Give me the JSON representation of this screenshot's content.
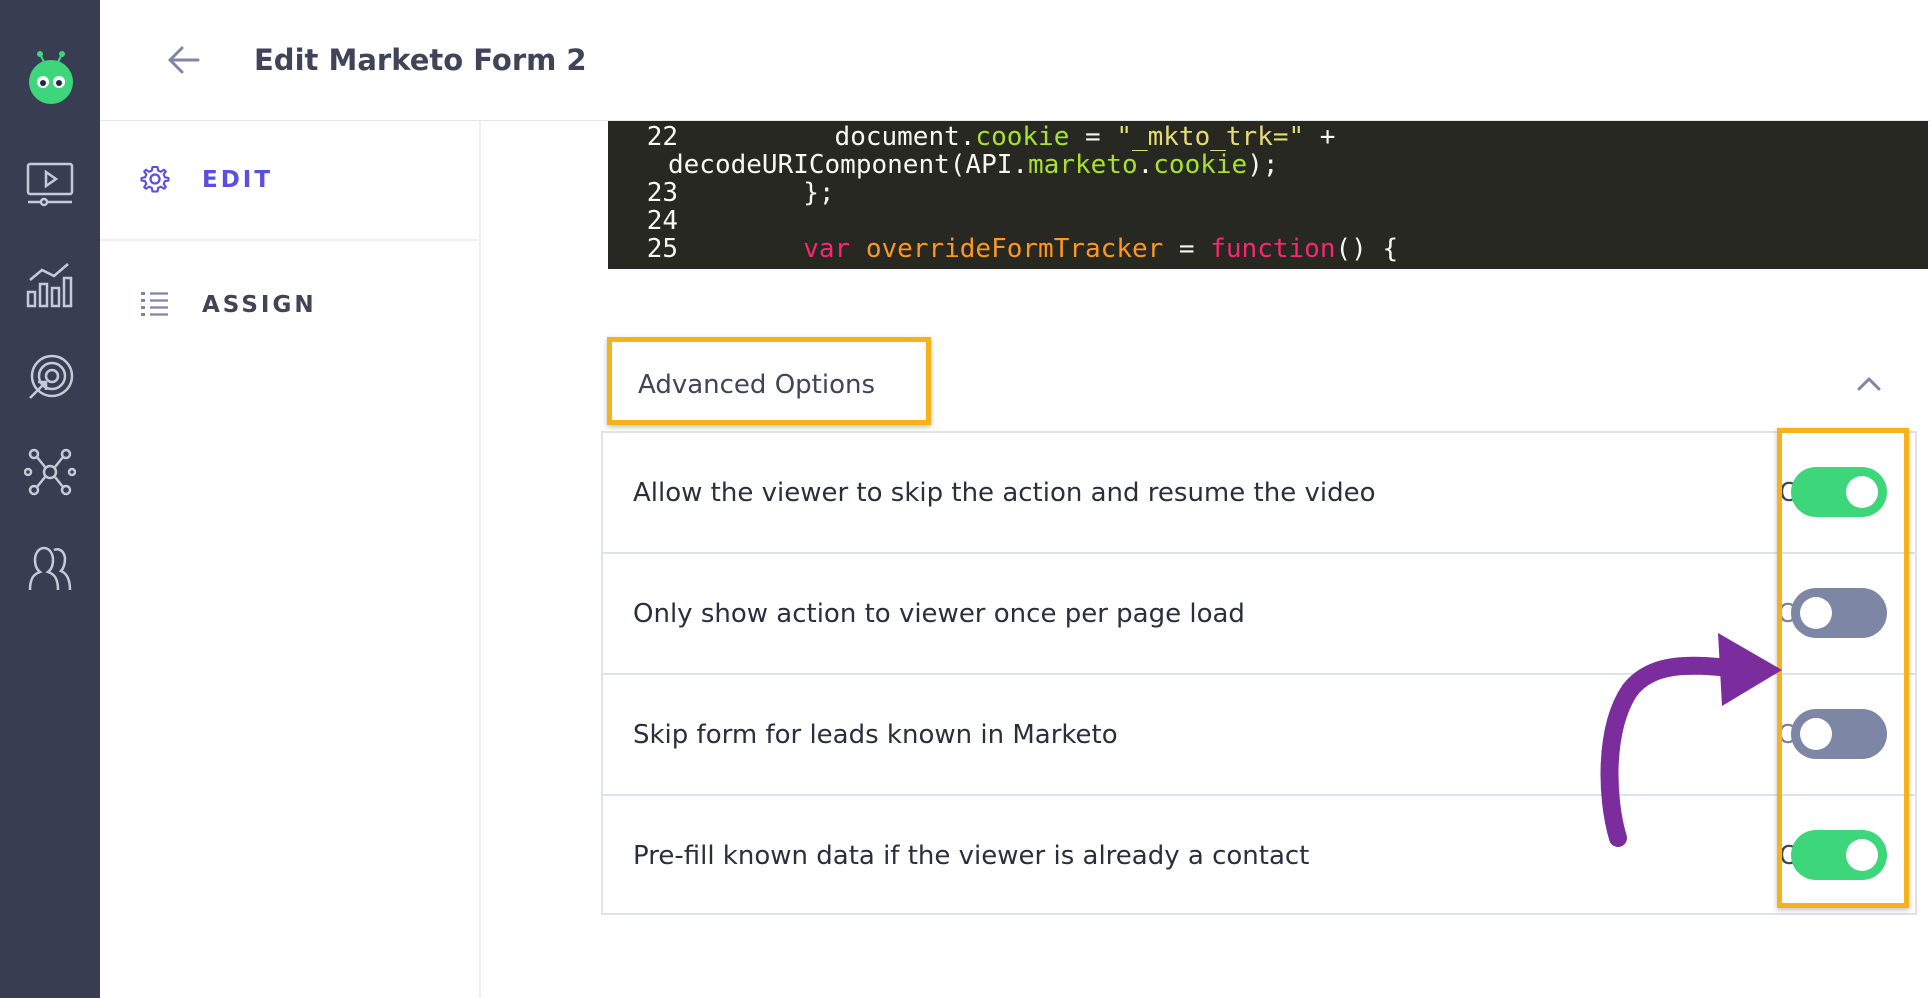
{
  "header": {
    "title": "Edit Marketo Form 2"
  },
  "subnav": {
    "items": [
      {
        "label": "EDIT",
        "icon": "gear-icon",
        "active": true
      },
      {
        "label": "ASSIGN",
        "icon": "list-icon",
        "active": false
      }
    ]
  },
  "code": {
    "lines": [
      {
        "num": "22",
        "parts": [
          {
            "t": "        document.",
            "c": ""
          },
          {
            "t": "cookie",
            "c": "c-prop"
          },
          {
            "t": " = ",
            "c": ""
          },
          {
            "t": "\"_mkto_trk=\"",
            "c": "c-str"
          },
          {
            "t": " +",
            "c": ""
          }
        ]
      },
      {
        "num": "",
        "parts": [
          {
            "t": "decodeURIComponent(API.",
            "c": ""
          },
          {
            "t": "marketo",
            "c": "c-prop"
          },
          {
            "t": ".",
            "c": ""
          },
          {
            "t": "cookie",
            "c": "c-prop"
          },
          {
            "t": ");",
            "c": ""
          }
        ]
      },
      {
        "num": "23",
        "parts": [
          {
            "t": "      };",
            "c": ""
          }
        ]
      },
      {
        "num": "24",
        "parts": [
          {
            "t": "",
            "c": ""
          }
        ]
      },
      {
        "num": "25",
        "parts": [
          {
            "t": "      ",
            "c": ""
          },
          {
            "t": "var",
            "c": "c-kw"
          },
          {
            "t": " ",
            "c": ""
          },
          {
            "t": "overrideFormTracker",
            "c": "c-fn"
          },
          {
            "t": " = ",
            "c": ""
          },
          {
            "t": "function",
            "c": "c-kw"
          },
          {
            "t": "() {",
            "c": ""
          }
        ]
      }
    ]
  },
  "advanced": {
    "title": "Advanced Options",
    "options": [
      {
        "label": "Allow the viewer to skip the action and resume the video",
        "status": "On",
        "enabled": true
      },
      {
        "label": "Only show action to viewer once per page load",
        "status": "Off",
        "enabled": false
      },
      {
        "label": "Skip form for leads known in Marketo",
        "status": "Off",
        "enabled": false
      },
      {
        "label": "Pre-fill known data if the viewer is already a contact",
        "status": "On",
        "enabled": true
      }
    ]
  },
  "colors": {
    "accent": "#5b4fe2",
    "toggle_on": "#3ed67b",
    "toggle_off": "#7d86a4",
    "highlight": "#f5b21b",
    "annotation_arrow": "#7b2d9e",
    "rail": "#383d52"
  }
}
